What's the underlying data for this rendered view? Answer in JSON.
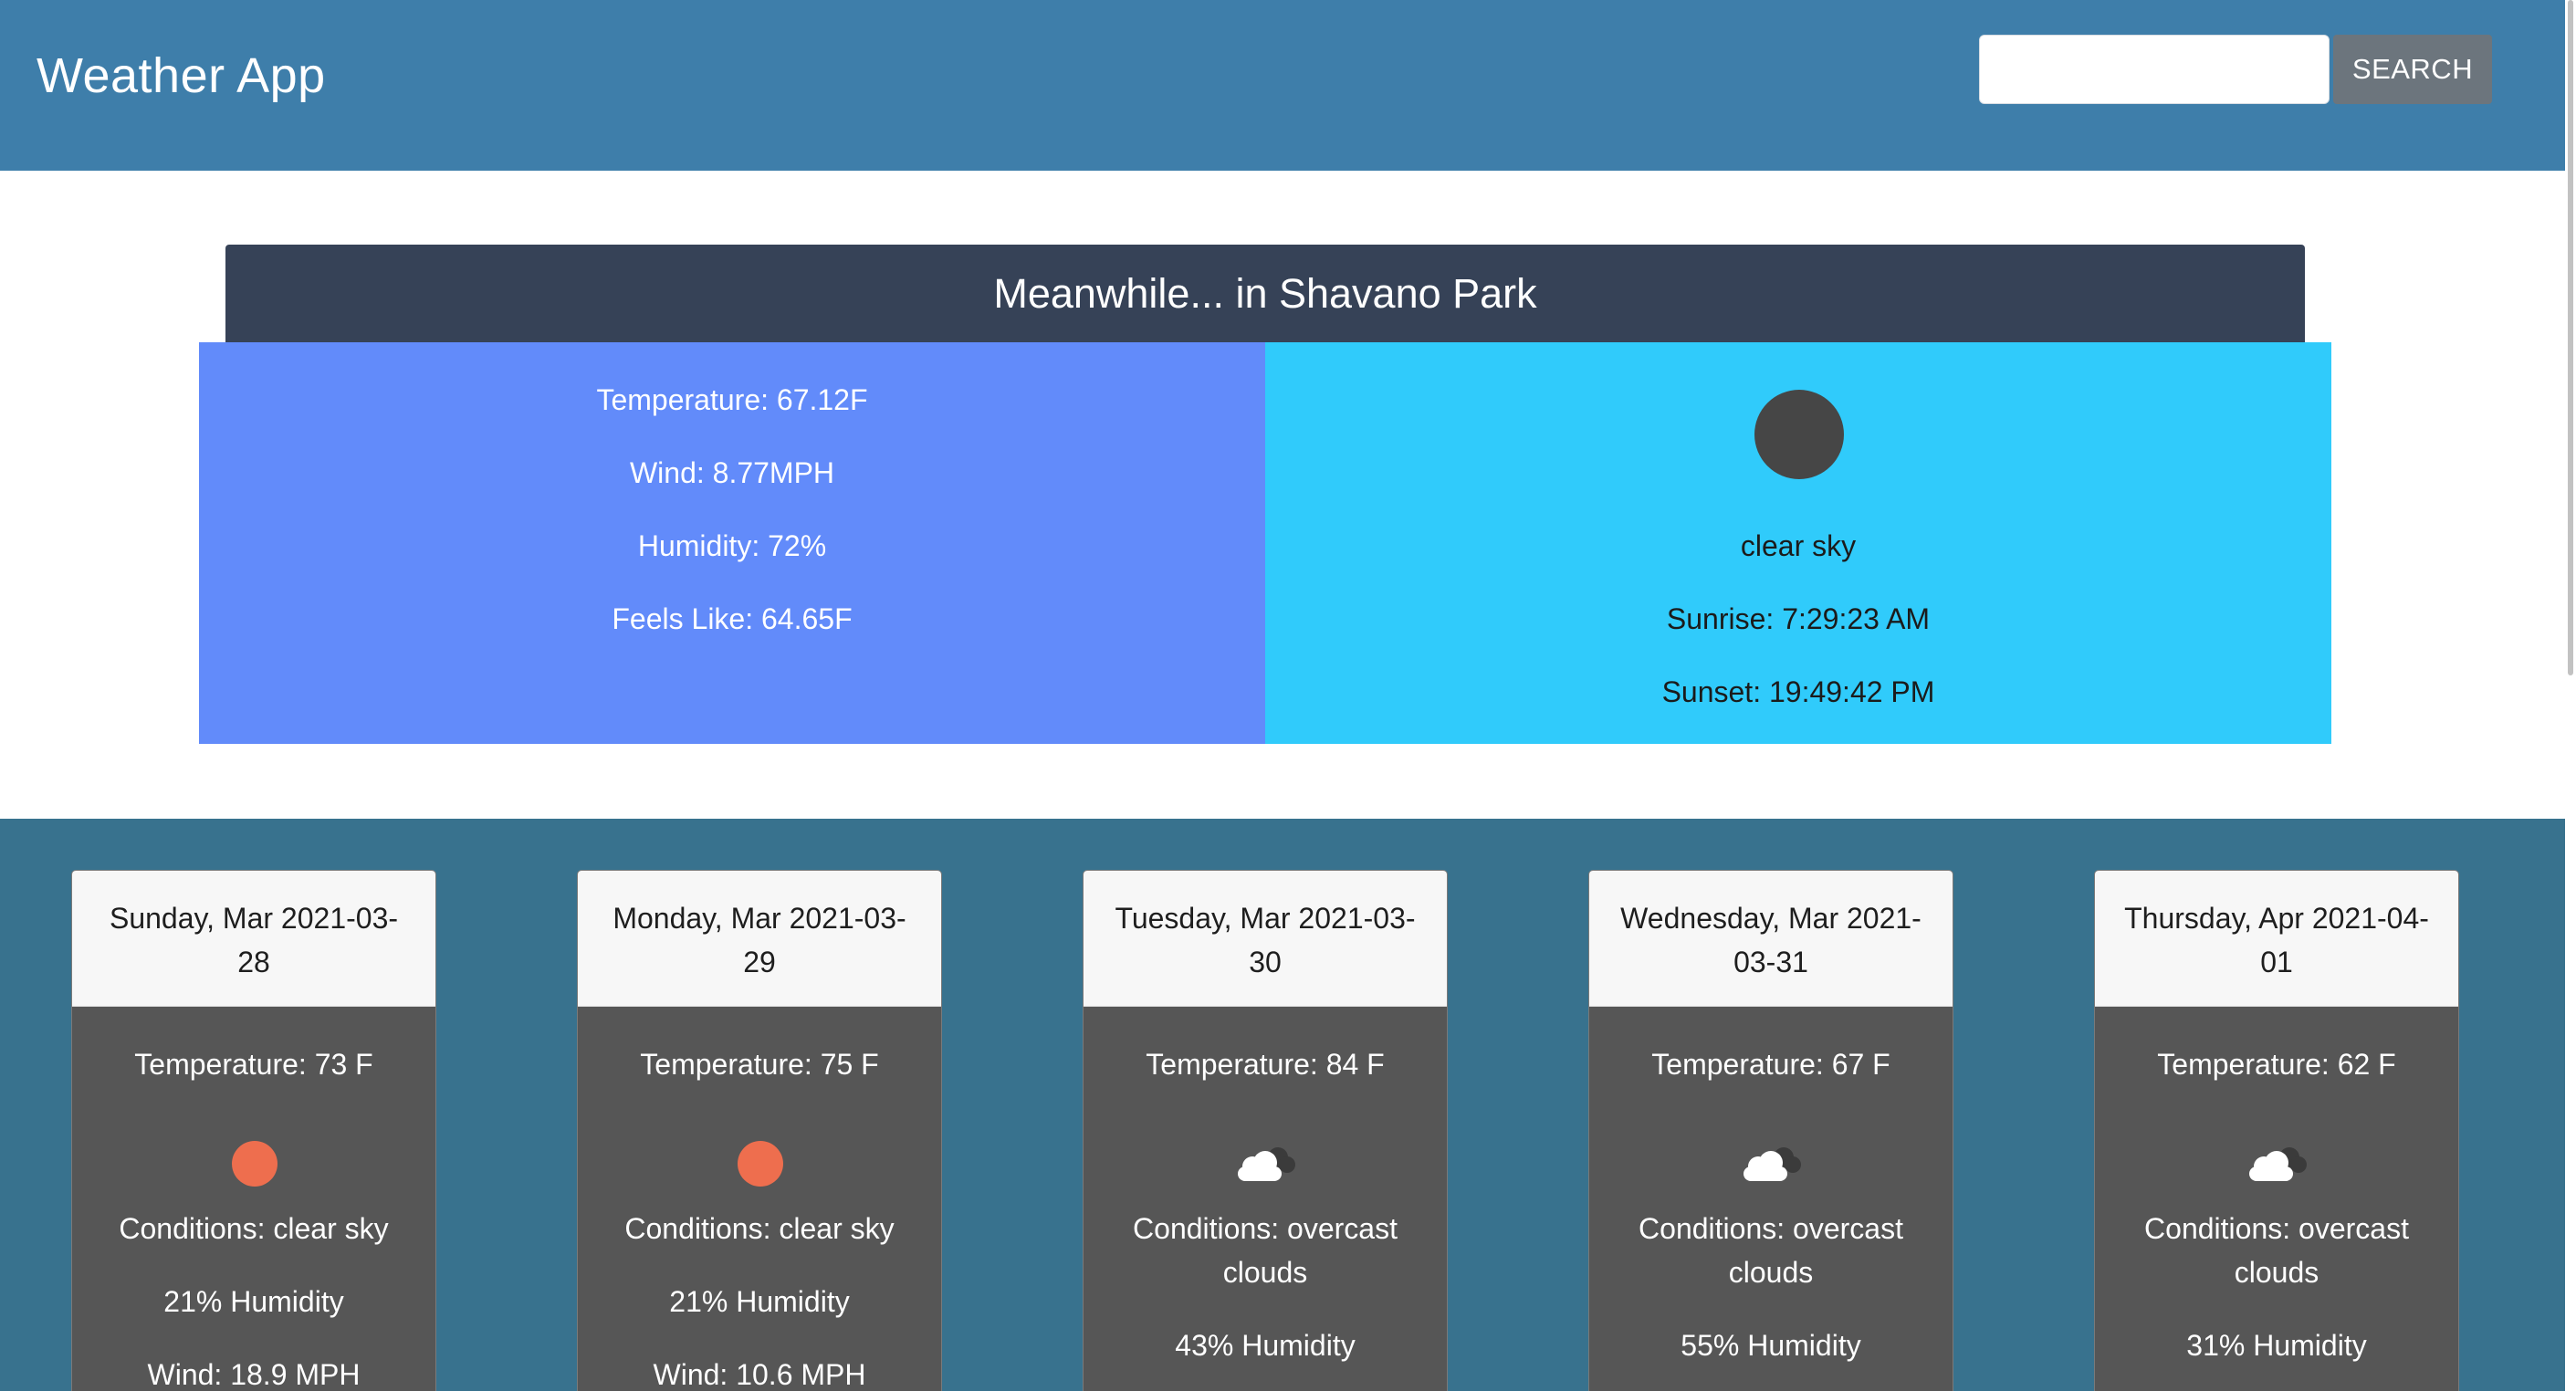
{
  "app": {
    "title": "Weather App",
    "search": {
      "value": "",
      "placeholder": "",
      "button_label": "SEARCH"
    }
  },
  "current": {
    "heading": "Meanwhile... in Shavano Park",
    "temperature": "Temperature: 67.12F",
    "wind": "Wind: 8.77MPH",
    "humidity": "Humidity: 72%",
    "feels_like": "Feels Like: 64.65F",
    "icon": "moon-icon",
    "conditions": "clear sky",
    "sunrise": "Sunrise: 7:29:23 AM",
    "sunset": "Sunset: 19:49:42 PM"
  },
  "forecast": [
    {
      "date": "Sunday, Mar 2021-03-28",
      "temperature": "Temperature: 73 F",
      "icon": "sun-icon",
      "conditions": "Conditions: clear sky",
      "humidity": "21% Humidity",
      "wind": "Wind: 18.9 MPH"
    },
    {
      "date": "Monday, Mar 2021-03-29",
      "temperature": "Temperature: 75 F",
      "icon": "sun-icon",
      "conditions": "Conditions: clear sky",
      "humidity": "21% Humidity",
      "wind": "Wind: 10.6 MPH"
    },
    {
      "date": "Tuesday, Mar 2021-03-30",
      "temperature": "Temperature: 84 F",
      "icon": "cloud-icon",
      "conditions": "Conditions: overcast clouds",
      "humidity": "43% Humidity"
    },
    {
      "date": "Wednesday, Mar 2021-03-31",
      "temperature": "Temperature: 67 F",
      "icon": "cloud-icon",
      "conditions": "Conditions: overcast clouds",
      "humidity": "55% Humidity"
    },
    {
      "date": "Thursday, Apr 2021-04-01",
      "temperature": "Temperature: 62 F",
      "icon": "cloud-icon",
      "conditions": "Conditions: overcast clouds",
      "humidity": "31% Humidity"
    }
  ],
  "colors": {
    "navbar": "#3e7eaa",
    "current_header": "#364257",
    "current_left": "#628bfa",
    "current_right": "#30cbfb",
    "forecast_bg": "#38728e",
    "card_body": "#565656",
    "sun": "#ee6e4e",
    "moon": "#464646"
  }
}
